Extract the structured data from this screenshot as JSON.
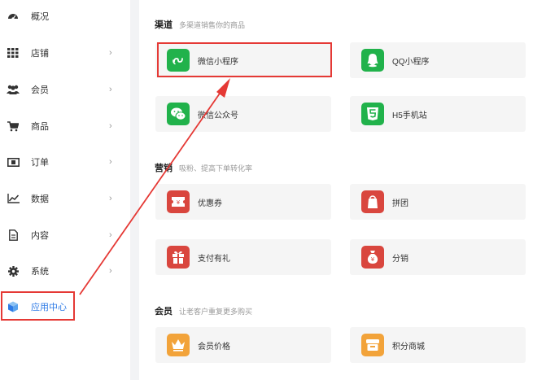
{
  "sidebar": {
    "items": [
      {
        "label": "概况",
        "icon": "dashboard-icon",
        "chevron": ""
      },
      {
        "label": "店铺",
        "icon": "grid-icon",
        "chevron": "›"
      },
      {
        "label": "会员",
        "icon": "users-icon",
        "chevron": "›"
      },
      {
        "label": "商品",
        "icon": "cart-icon",
        "chevron": "›"
      },
      {
        "label": "订单",
        "icon": "order-icon",
        "chevron": "›"
      },
      {
        "label": "数据",
        "icon": "chart-icon",
        "chevron": "›"
      },
      {
        "label": "内容",
        "icon": "document-icon",
        "chevron": "›"
      },
      {
        "label": "系统",
        "icon": "gear-icon",
        "chevron": "›"
      },
      {
        "label": "应用中心",
        "icon": "cube-icon",
        "chevron": ""
      }
    ]
  },
  "sections": {
    "channel": {
      "title": "渠道",
      "subtitle": "多渠道销售你的商品"
    },
    "marketing": {
      "title": "营销",
      "subtitle": "吸粉、提高下单转化率"
    },
    "member": {
      "title": "会员",
      "subtitle": "让老客户重复更多购买"
    }
  },
  "cards": {
    "wechat_mini": "微信小程序",
    "qq_mini": "QQ小程序",
    "wechat_official": "微信公众号",
    "h5_site": "H5手机站",
    "coupon": "优惠券",
    "group_buy": "拼团",
    "pay_gift": "支付有礼",
    "distribution": "分销",
    "member_price": "会员价格",
    "points_mall": "积分商城"
  },
  "colors": {
    "green": "#21b24b",
    "red": "#d9463e",
    "orange": "#f2a33a",
    "accent": "#2f7be6",
    "annotation": "#e53935"
  }
}
